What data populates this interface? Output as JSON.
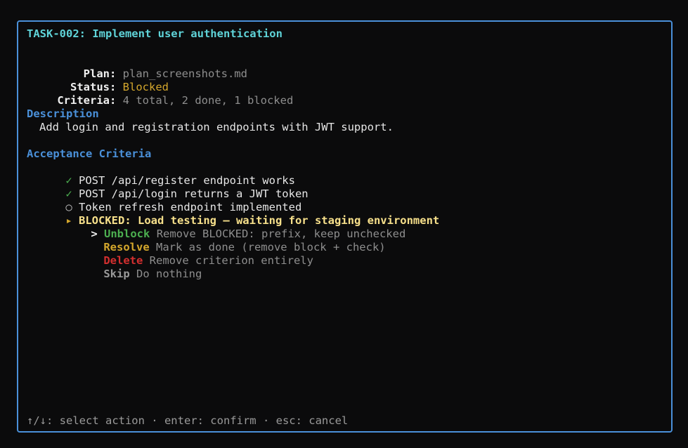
{
  "task": {
    "title": "TASK-002: Implement user authentication"
  },
  "meta": {
    "plan_label": "Plan:",
    "plan_value": "plan_screenshots.md",
    "status_label": "Status:",
    "status_value": "Blocked",
    "criteria_label": "Criteria:",
    "criteria_value": "4 total, 2 done, 1 blocked"
  },
  "description": {
    "heading": "Description",
    "text": "Add login and registration endpoints with JWT support."
  },
  "criteria": {
    "heading": "Acceptance Criteria",
    "items": [
      {
        "marker": "✓",
        "text": "POST /api/register endpoint works"
      },
      {
        "marker": "✓",
        "text": "POST /api/login returns a JWT token"
      },
      {
        "marker": "○",
        "text": "Token refresh endpoint implemented"
      },
      {
        "marker": "▸",
        "text": "BLOCKED: Load testing — waiting for staging environment"
      }
    ]
  },
  "actions": {
    "cursor": ">",
    "items": [
      {
        "label": "Unblock",
        "desc": "Remove BLOCKED: prefix, keep unchecked"
      },
      {
        "label": "Resolve",
        "desc": "Mark as done (remove block + check)"
      },
      {
        "label": "Delete",
        "desc": "Remove criterion entirely"
      },
      {
        "label": "Skip",
        "desc": "Do nothing"
      }
    ]
  },
  "footer": {
    "hint": "↑/↓: select action · enter: confirm · esc: cancel"
  },
  "colors": {
    "border": "#4a90d9",
    "title": "#5fd3d8",
    "section": "#4a90d9",
    "done": "#4caf50",
    "blocked": "#d4a72c",
    "delete": "#d32f2f"
  }
}
